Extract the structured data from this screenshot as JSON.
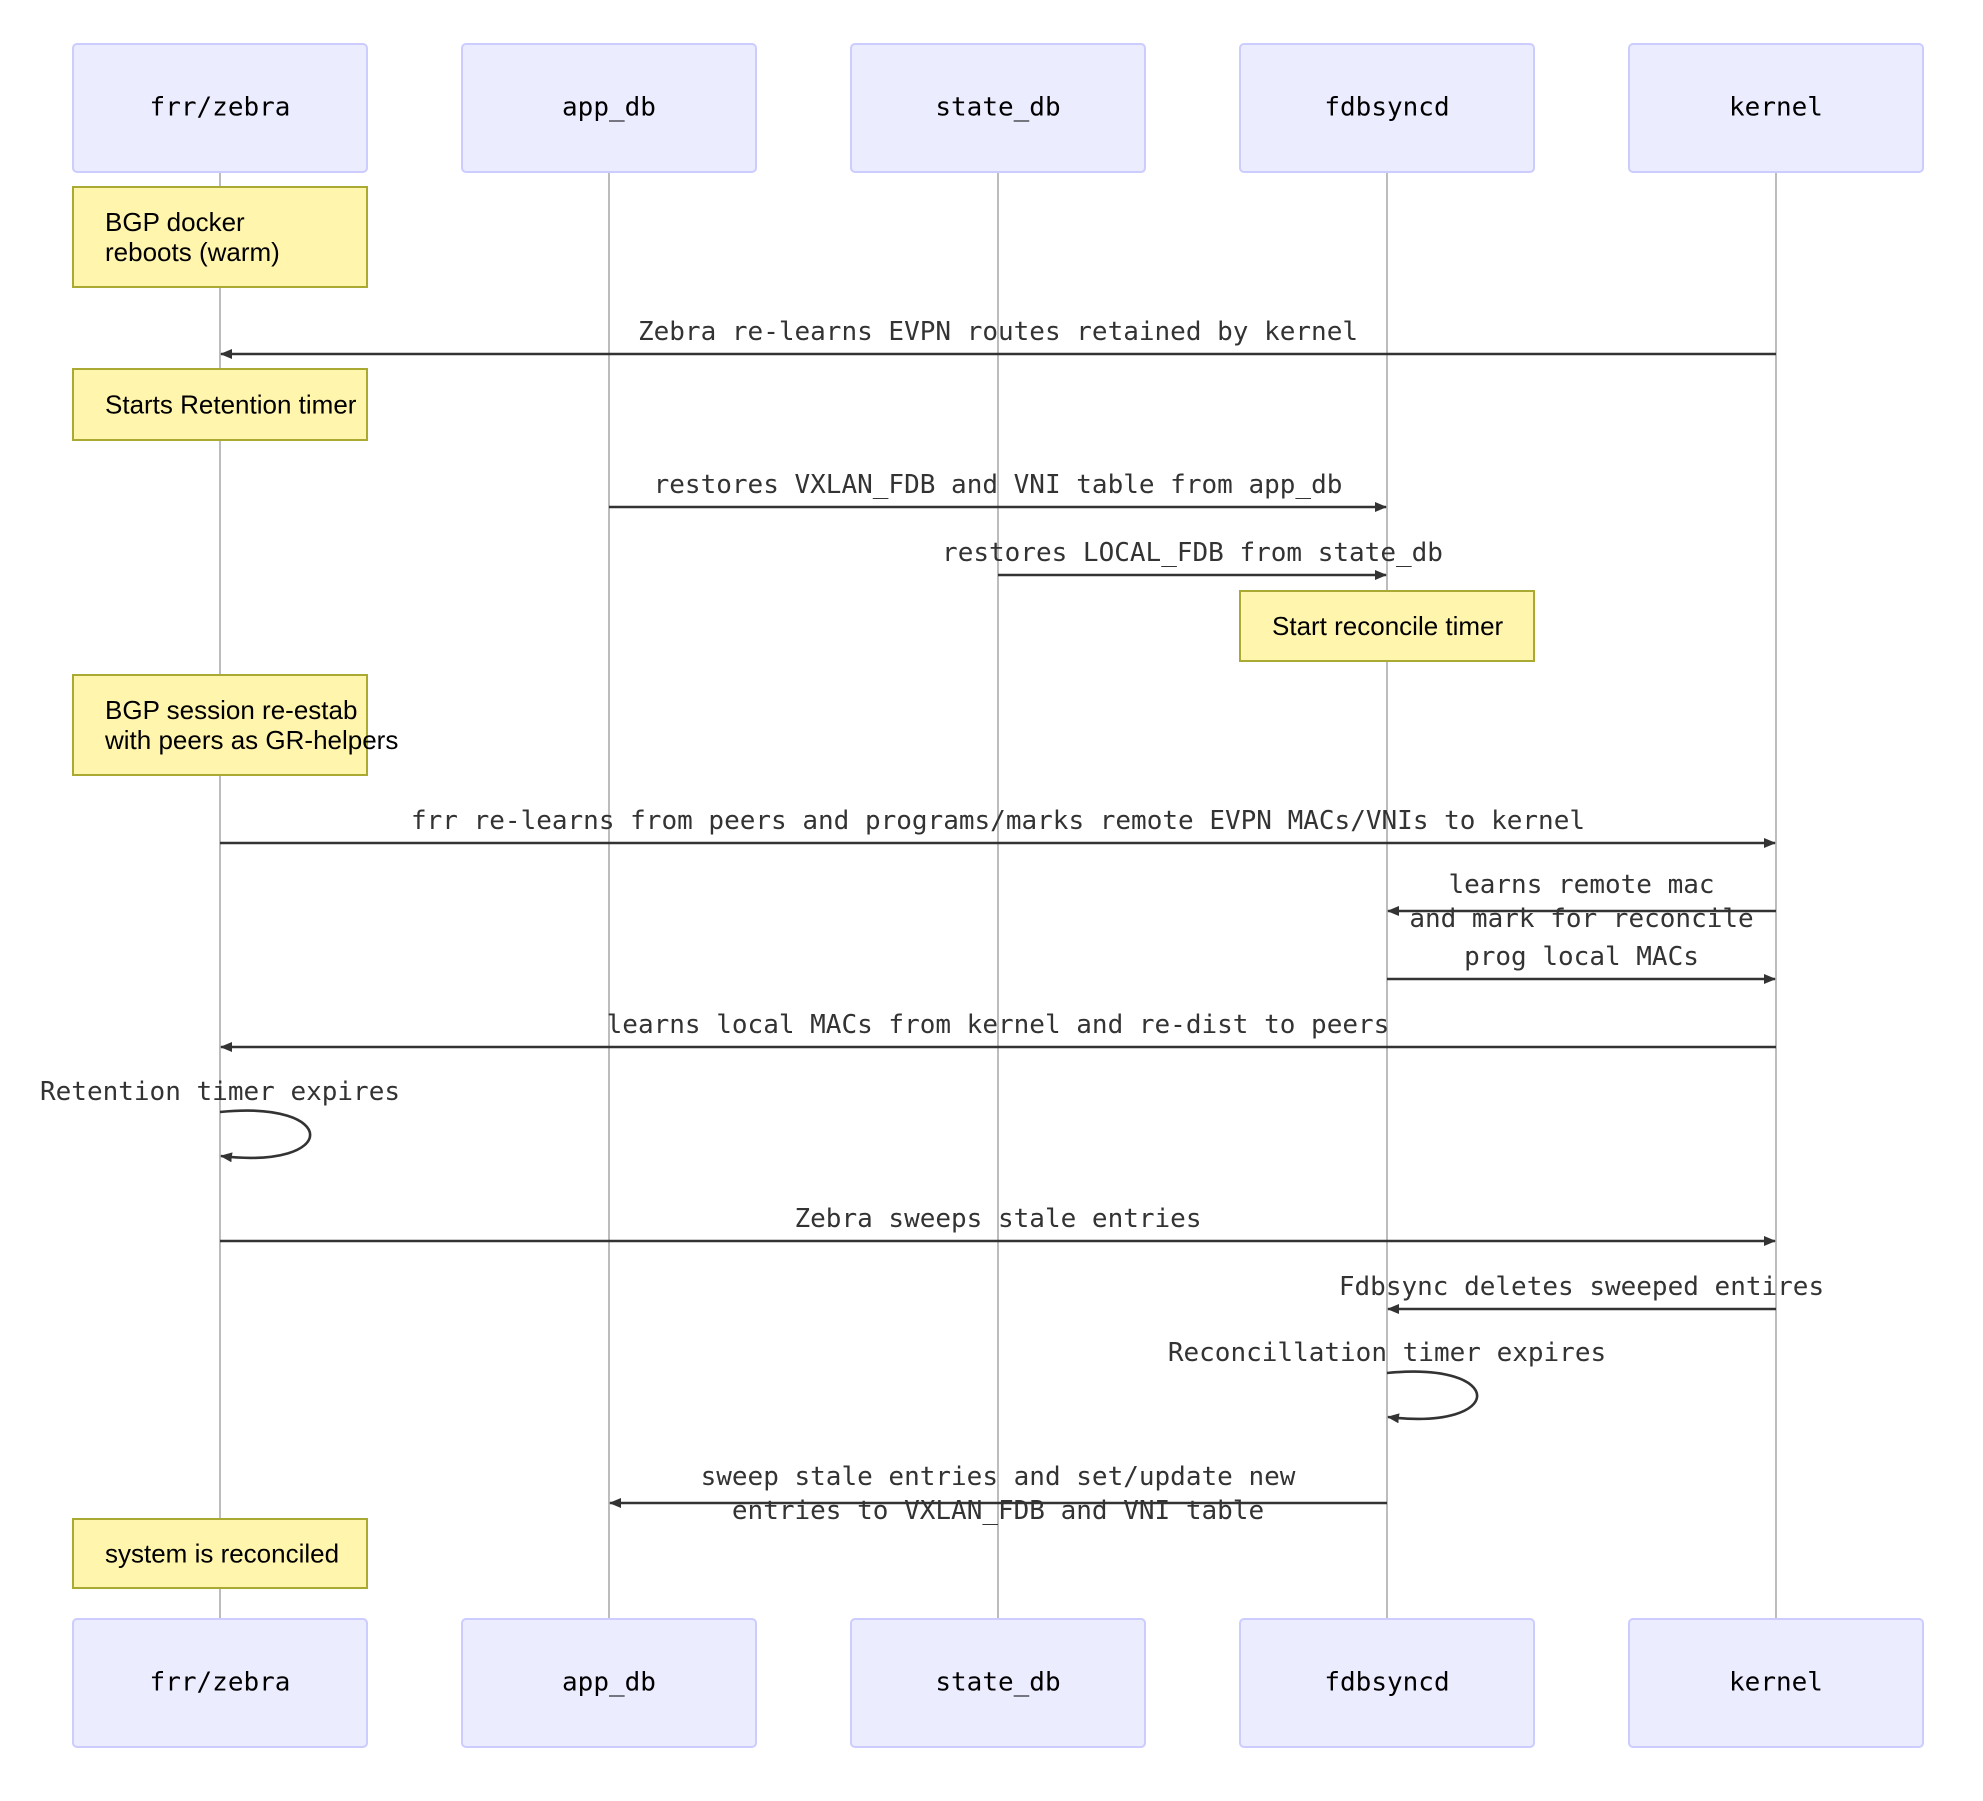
{
  "diagram": {
    "type": "sequence",
    "actors": [
      {
        "id": "frr",
        "label": "frr/zebra"
      },
      {
        "id": "app",
        "label": "app_db"
      },
      {
        "id": "state",
        "label": "state_db"
      },
      {
        "id": "fdb",
        "label": "fdbsyncd"
      },
      {
        "id": "kernel",
        "label": "kernel"
      }
    ],
    "steps": [
      {
        "kind": "note",
        "over": "frr",
        "lines": [
          "BGP docker",
          "reboots (warm)"
        ]
      },
      {
        "kind": "message",
        "from": "kernel",
        "to": "frr",
        "lines": [
          "Zebra re-learns EVPN routes retained by kernel"
        ]
      },
      {
        "kind": "note",
        "over": "frr",
        "lines": [
          "Starts Retention timer"
        ]
      },
      {
        "kind": "message",
        "from": "app",
        "to": "fdb",
        "lines": [
          "restores VXLAN_FDB and VNI table from app_db"
        ]
      },
      {
        "kind": "message",
        "from": "state",
        "to": "fdb",
        "lines": [
          "restores LOCAL_FDB from state_db"
        ]
      },
      {
        "kind": "note",
        "over": "fdb",
        "lines": [
          "Start reconcile timer"
        ]
      },
      {
        "kind": "note",
        "over": "frr",
        "lines": [
          "BGP session re-estab",
          "with peers as GR-helpers"
        ]
      },
      {
        "kind": "message",
        "from": "frr",
        "to": "kernel",
        "lines": [
          "frr re-learns from peers and programs/marks remote EVPN MACs/VNIs to kernel"
        ]
      },
      {
        "kind": "message",
        "from": "kernel",
        "to": "fdb",
        "lines": [
          "learns remote mac",
          "and mark for reconcile"
        ]
      },
      {
        "kind": "message",
        "from": "fdb",
        "to": "kernel",
        "lines": [
          "prog local MACs"
        ]
      },
      {
        "kind": "message",
        "from": "kernel",
        "to": "frr",
        "lines": [
          "learns local MACs from kernel and re-dist to peers"
        ]
      },
      {
        "kind": "self",
        "actor": "frr",
        "lines": [
          "Retention timer expires"
        ]
      },
      {
        "kind": "message",
        "from": "frr",
        "to": "kernel",
        "lines": [
          "Zebra sweeps stale entries"
        ]
      },
      {
        "kind": "message",
        "from": "kernel",
        "to": "fdb",
        "lines": [
          "Fdbsync deletes sweeped entires"
        ]
      },
      {
        "kind": "self",
        "actor": "fdb",
        "lines": [
          "Reconcillation timer expires"
        ]
      },
      {
        "kind": "message",
        "from": "fdb",
        "to": "app",
        "lines": [
          "sweep stale entries and set/update new",
          "entries to VXLAN_FDB and VNI table"
        ]
      },
      {
        "kind": "note",
        "over": "frr",
        "lines": [
          "system is reconciled"
        ]
      }
    ],
    "colors": {
      "actor_fill": "#ECECFF",
      "actor_border": "#CCCCFF",
      "note_fill": "#FFF5AD",
      "note_border": "#AAAA33",
      "message_line": "#333333",
      "lifeline": "#999999"
    }
  }
}
